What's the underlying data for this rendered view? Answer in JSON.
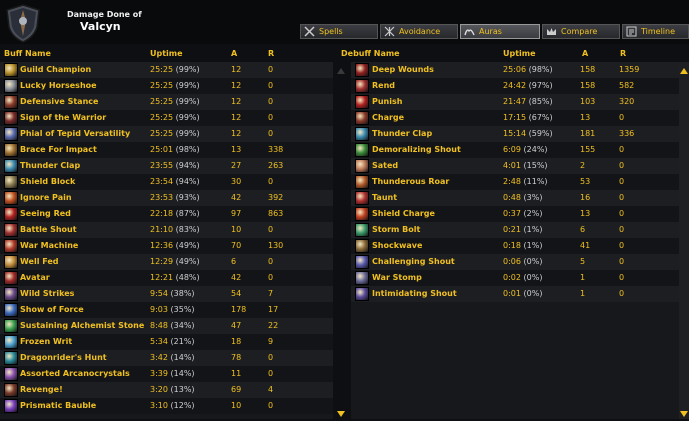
{
  "header": {
    "subtitle": "Damage Done of",
    "player": "Valcyn"
  },
  "tabs": [
    {
      "label": "Spells",
      "icon": "swords-icon",
      "active": false
    },
    {
      "label": "Avoidance",
      "icon": "cross-swords-icon",
      "active": false
    },
    {
      "label": "Auras",
      "icon": "hands-icon",
      "active": true
    },
    {
      "label": "Compare",
      "icon": "crown-icon",
      "active": false
    },
    {
      "label": "Timeline",
      "icon": "timeline-icon",
      "active": false
    }
  ],
  "buff_columns": {
    "name": "Buff Name",
    "uptime": "Uptime",
    "a": "A",
    "r": "R"
  },
  "debuff_columns": {
    "name": "Debuff Name",
    "uptime": "Uptime",
    "a": "A",
    "r": "R"
  },
  "buffs": [
    {
      "name": "Guild Champion",
      "time": "25:25",
      "pct": "(99%)",
      "a": "12",
      "r": "0",
      "icon": "guild-champion-icon",
      "color": "#b8902a"
    },
    {
      "name": "Lucky Horseshoe",
      "time": "25:25",
      "pct": "(99%)",
      "a": "12",
      "r": "0",
      "icon": "horseshoe-icon",
      "color": "#8a8f99"
    },
    {
      "name": "Defensive Stance",
      "time": "25:25",
      "pct": "(99%)",
      "a": "12",
      "r": "0",
      "icon": "defensive-stance-icon",
      "color": "#8a3a2a"
    },
    {
      "name": "Sign of the Warrior",
      "time": "25:25",
      "pct": "(99%)",
      "a": "12",
      "r": "0",
      "icon": "warrior-sign-icon",
      "color": "#7a2a2a"
    },
    {
      "name": "Phial of Tepid Versatility",
      "time": "25:25",
      "pct": "(99%)",
      "a": "12",
      "r": "0",
      "icon": "phial-icon",
      "color": "#5a6ab0"
    },
    {
      "name": "Brace For Impact",
      "time": "25:01",
      "pct": "(98%)",
      "a": "13",
      "r": "338",
      "icon": "brace-icon",
      "color": "#a07030"
    },
    {
      "name": "Thunder Clap",
      "time": "23:55",
      "pct": "(94%)",
      "a": "27",
      "r": "263",
      "icon": "thunder-clap-icon",
      "color": "#3a8ab0"
    },
    {
      "name": "Shield Block",
      "time": "23:54",
      "pct": "(94%)",
      "a": "30",
      "r": "0",
      "icon": "shield-block-icon",
      "color": "#8a7a50"
    },
    {
      "name": "Ignore Pain",
      "time": "23:53",
      "pct": "(93%)",
      "a": "42",
      "r": "392",
      "icon": "ignore-pain-icon",
      "color": "#c05020"
    },
    {
      "name": "Seeing Red",
      "time": "22:18",
      "pct": "(87%)",
      "a": "97",
      "r": "863",
      "icon": "seeing-red-icon",
      "color": "#b02020"
    },
    {
      "name": "Battle Shout",
      "time": "21:10",
      "pct": "(83%)",
      "a": "10",
      "r": "0",
      "icon": "battle-shout-icon",
      "color": "#a03030"
    },
    {
      "name": "War Machine",
      "time": "12:36",
      "pct": "(49%)",
      "a": "70",
      "r": "130",
      "icon": "war-machine-icon",
      "color": "#b03a2a"
    },
    {
      "name": "Well Fed",
      "time": "12:29",
      "pct": "(49%)",
      "a": "6",
      "r": "0",
      "icon": "well-fed-icon",
      "color": "#c08a3a"
    },
    {
      "name": "Avatar",
      "time": "12:21",
      "pct": "(48%)",
      "a": "42",
      "r": "0",
      "icon": "avatar-icon",
      "color": "#a02a2a"
    },
    {
      "name": "Wild Strikes",
      "time": "9:54",
      "pct": "(38%)",
      "a": "54",
      "r": "7",
      "icon": "wild-strikes-icon",
      "color": "#6a4a8a"
    },
    {
      "name": "Show of Force",
      "time": "9:03",
      "pct": "(35%)",
      "a": "178",
      "r": "17",
      "icon": "show-of-force-icon",
      "color": "#3a6ac0"
    },
    {
      "name": "Sustaining Alchemist Stone",
      "time": "8:48",
      "pct": "(34%)",
      "a": "47",
      "r": "22",
      "icon": "alchemist-stone-icon",
      "color": "#3aa050"
    },
    {
      "name": "Frozen Writ",
      "time": "5:34",
      "pct": "(21%)",
      "a": "18",
      "r": "9",
      "icon": "frozen-writ-icon",
      "color": "#4aa0d0"
    },
    {
      "name": "Dragonrider's Hunt",
      "time": "3:42",
      "pct": "(14%)",
      "a": "78",
      "r": "0",
      "icon": "dragonrider-icon",
      "color": "#2a8a9a"
    },
    {
      "name": "Assorted Arcanocrystals",
      "time": "3:39",
      "pct": "(14%)",
      "a": "11",
      "r": "0",
      "icon": "arcanocrystals-icon",
      "color": "#8a50b0"
    },
    {
      "name": "Revenge!",
      "time": "3:20",
      "pct": "(13%)",
      "a": "69",
      "r": "4",
      "icon": "revenge-icon",
      "color": "#7a3a2a"
    },
    {
      "name": "Prismatic Bauble",
      "time": "3:10",
      "pct": "(12%)",
      "a": "10",
      "r": "0",
      "icon": "bauble-icon",
      "color": "#7a40c0"
    }
  ],
  "debuffs": [
    {
      "name": "Deep Wounds",
      "time": "25:06",
      "pct": "(98%)",
      "a": "158",
      "r": "1359",
      "icon": "deep-wounds-icon",
      "color": "#902020"
    },
    {
      "name": "Rend",
      "time": "24:42",
      "pct": "(97%)",
      "a": "158",
      "r": "582",
      "icon": "rend-icon",
      "color": "#a03030"
    },
    {
      "name": "Punish",
      "time": "21:47",
      "pct": "(85%)",
      "a": "103",
      "r": "320",
      "icon": "punish-icon",
      "color": "#b02020"
    },
    {
      "name": "Charge",
      "time": "17:15",
      "pct": "(67%)",
      "a": "13",
      "r": "0",
      "icon": "charge-icon",
      "color": "#8a3a2a"
    },
    {
      "name": "Thunder Clap",
      "time": "15:14",
      "pct": "(59%)",
      "a": "181",
      "r": "336",
      "icon": "thunder-clap-icon",
      "color": "#3a8ab0"
    },
    {
      "name": "Demoralizing Shout",
      "time": "6:09",
      "pct": "(24%)",
      "a": "155",
      "r": "0",
      "icon": "demoralizing-shout-icon",
      "color": "#3a8a3a"
    },
    {
      "name": "Sated",
      "time": "4:01",
      "pct": "(15%)",
      "a": "2",
      "r": "0",
      "icon": "sated-icon",
      "color": "#c07a5a"
    },
    {
      "name": "Thunderous Roar",
      "time": "2:48",
      "pct": "(11%)",
      "a": "53",
      "r": "0",
      "icon": "thunderous-roar-icon",
      "color": "#b05a2a"
    },
    {
      "name": "Taunt",
      "time": "0:48",
      "pct": "(3%)",
      "a": "16",
      "r": "0",
      "icon": "taunt-icon",
      "color": "#b03030"
    },
    {
      "name": "Shield Charge",
      "time": "0:37",
      "pct": "(2%)",
      "a": "13",
      "r": "0",
      "icon": "shield-charge-icon",
      "color": "#c04020"
    },
    {
      "name": "Storm Bolt",
      "time": "0:21",
      "pct": "(1%)",
      "a": "6",
      "r": "0",
      "icon": "storm-bolt-icon",
      "color": "#3a9a6a"
    },
    {
      "name": "Shockwave",
      "time": "0:18",
      "pct": "(1%)",
      "a": "41",
      "r": "0",
      "icon": "shockwave-icon",
      "color": "#8a6a3a"
    },
    {
      "name": "Challenging Shout",
      "time": "0:06",
      "pct": "(0%)",
      "a": "5",
      "r": "0",
      "icon": "challenging-shout-icon",
      "color": "#5a5ab0"
    },
    {
      "name": "War Stomp",
      "time": "0:02",
      "pct": "(0%)",
      "a": "1",
      "r": "0",
      "icon": "war-stomp-icon",
      "color": "#6a6a9a"
    },
    {
      "name": "Intimidating Shout",
      "time": "0:01",
      "pct": "(0%)",
      "a": "1",
      "r": "0",
      "icon": "intimidating-shout-icon",
      "color": "#5a4a9a"
    }
  ],
  "colors": {
    "accent": "#f0c020",
    "panel": "#17181b",
    "header": "#090a0c"
  }
}
